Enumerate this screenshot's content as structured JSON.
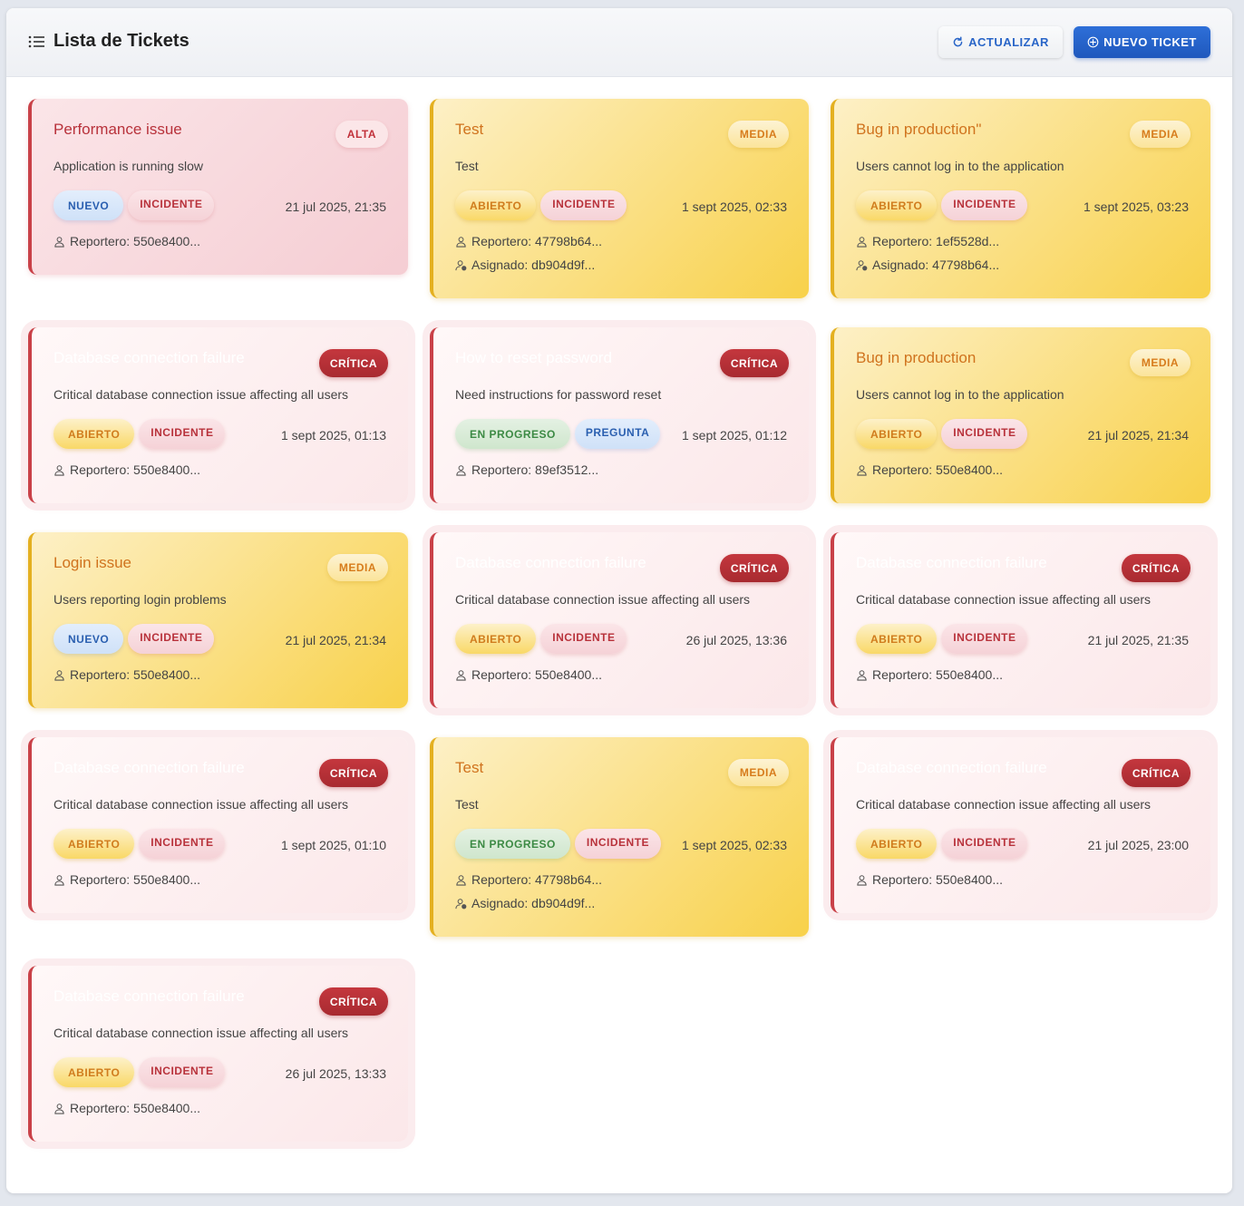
{
  "header": {
    "title": "Lista de Tickets",
    "refresh_label": "ACTUALIZAR",
    "new_label": "NUEVO TICKET"
  },
  "colors": {
    "primary": "#1f58bd",
    "alta": "#c94148",
    "media": "#e4b020",
    "critica": "#a82a30"
  },
  "tickets": [
    {
      "title": "Performance issue",
      "priority": "ALTA",
      "description": "Application is running slow",
      "status": "NUEVO",
      "type": "INCIDENTE",
      "date": "21 jul 2025, 21:35",
      "reporter": "Reportero: 550e8400...",
      "assigned": ""
    },
    {
      "title": "Test",
      "priority": "MEDIA",
      "description": "Test",
      "status": "ABIERTO",
      "type": "INCIDENTE",
      "date": "1 sept 2025, 02:33",
      "reporter": "Reportero: 47798b64...",
      "assigned": "Asignado: db904d9f..."
    },
    {
      "title": "Bug in production\"",
      "priority": "MEDIA",
      "description": "Users cannot log in to the application",
      "status": "ABIERTO",
      "type": "INCIDENTE",
      "date": "1 sept 2025, 03:23",
      "reporter": "Reportero: 1ef5528d...",
      "assigned": "Asignado: 47798b64..."
    },
    {
      "title": "Database connection failure",
      "priority": "CRÍTICA",
      "description": "Critical database connection issue affecting all users",
      "status": "ABIERTO",
      "type": "INCIDENTE",
      "date": "1 sept 2025, 01:13",
      "reporter": "Reportero: 550e8400...",
      "assigned": ""
    },
    {
      "title": "How to reset password",
      "priority": "CRÍTICA",
      "description": "Need instructions for password reset",
      "status": "EN PROGRESO",
      "type": "PREGUNTA",
      "date": "1 sept 2025, 01:12",
      "reporter": "Reportero: 89ef3512...",
      "assigned": ""
    },
    {
      "title": "Bug in production",
      "priority": "MEDIA",
      "description": "Users cannot log in to the application",
      "status": "ABIERTO",
      "type": "INCIDENTE",
      "date": "21 jul 2025, 21:34",
      "reporter": "Reportero: 550e8400...",
      "assigned": ""
    },
    {
      "title": "Login issue",
      "priority": "MEDIA",
      "description": "Users reporting login problems",
      "status": "NUEVO",
      "type": "INCIDENTE",
      "date": "21 jul 2025, 21:34",
      "reporter": "Reportero: 550e8400...",
      "assigned": ""
    },
    {
      "title": "Database connection failure",
      "priority": "CRÍTICA",
      "description": "Critical database connection issue affecting all users",
      "status": "ABIERTO",
      "type": "INCIDENTE",
      "date": "26 jul 2025, 13:36",
      "reporter": "Reportero: 550e8400...",
      "assigned": ""
    },
    {
      "title": "Database connection failure",
      "priority": "CRÍTICA",
      "description": "Critical database connection issue affecting all users",
      "status": "ABIERTO",
      "type": "INCIDENTE",
      "date": "21 jul 2025, 21:35",
      "reporter": "Reportero: 550e8400...",
      "assigned": ""
    },
    {
      "title": "Database connection failure",
      "priority": "CRÍTICA",
      "description": "Critical database connection issue affecting all users",
      "status": "ABIERTO",
      "type": "INCIDENTE",
      "date": "1 sept 2025, 01:10",
      "reporter": "Reportero: 550e8400...",
      "assigned": ""
    },
    {
      "title": "Test",
      "priority": "MEDIA",
      "description": "Test",
      "status": "EN PROGRESO",
      "type": "INCIDENTE",
      "date": "1 sept 2025, 02:33",
      "reporter": "Reportero: 47798b64...",
      "assigned": "Asignado: db904d9f..."
    },
    {
      "title": "Database connection failure",
      "priority": "CRÍTICA",
      "description": "Critical database connection issue affecting all users",
      "status": "ABIERTO",
      "type": "INCIDENTE",
      "date": "21 jul 2025, 23:00",
      "reporter": "Reportero: 550e8400...",
      "assigned": ""
    },
    {
      "title": "Database connection failure",
      "priority": "CRÍTICA",
      "description": "Critical database connection issue affecting all users",
      "status": "ABIERTO",
      "type": "INCIDENTE",
      "date": "26 jul 2025, 13:33",
      "reporter": "Reportero: 550e8400...",
      "assigned": ""
    }
  ]
}
